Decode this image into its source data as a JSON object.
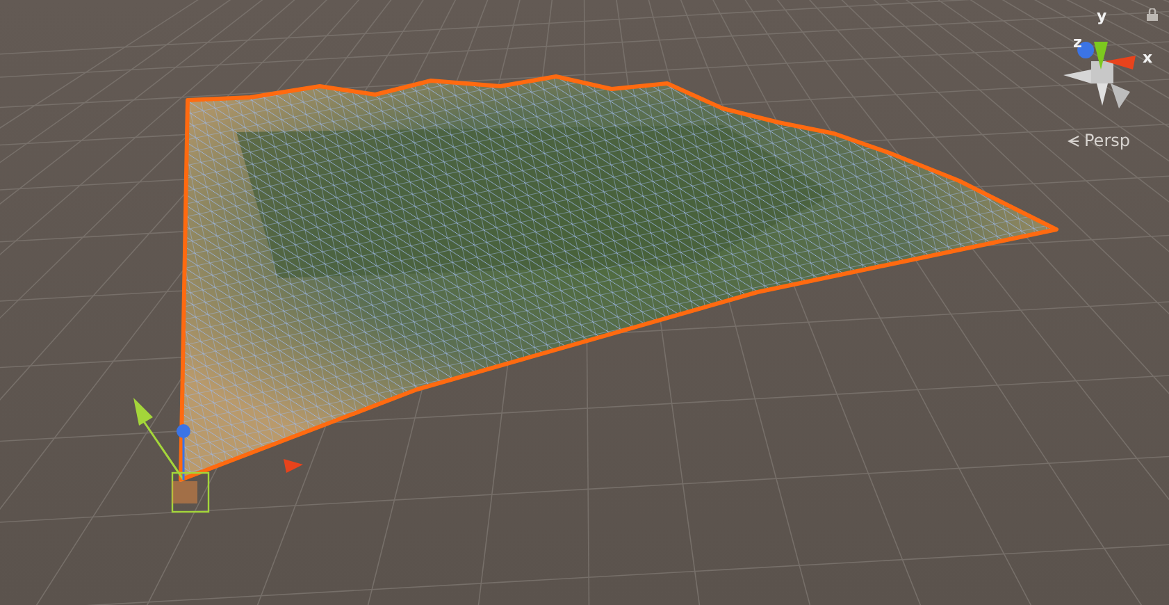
{
  "scene_view": {
    "projection": "Persp"
  },
  "orientation_gizmo": {
    "axes": [
      {
        "label": "y",
        "color": "#7cc91e"
      },
      {
        "label": "z",
        "color": "#3b74e6"
      },
      {
        "label": "x",
        "color": "#e8431c"
      }
    ]
  }
}
